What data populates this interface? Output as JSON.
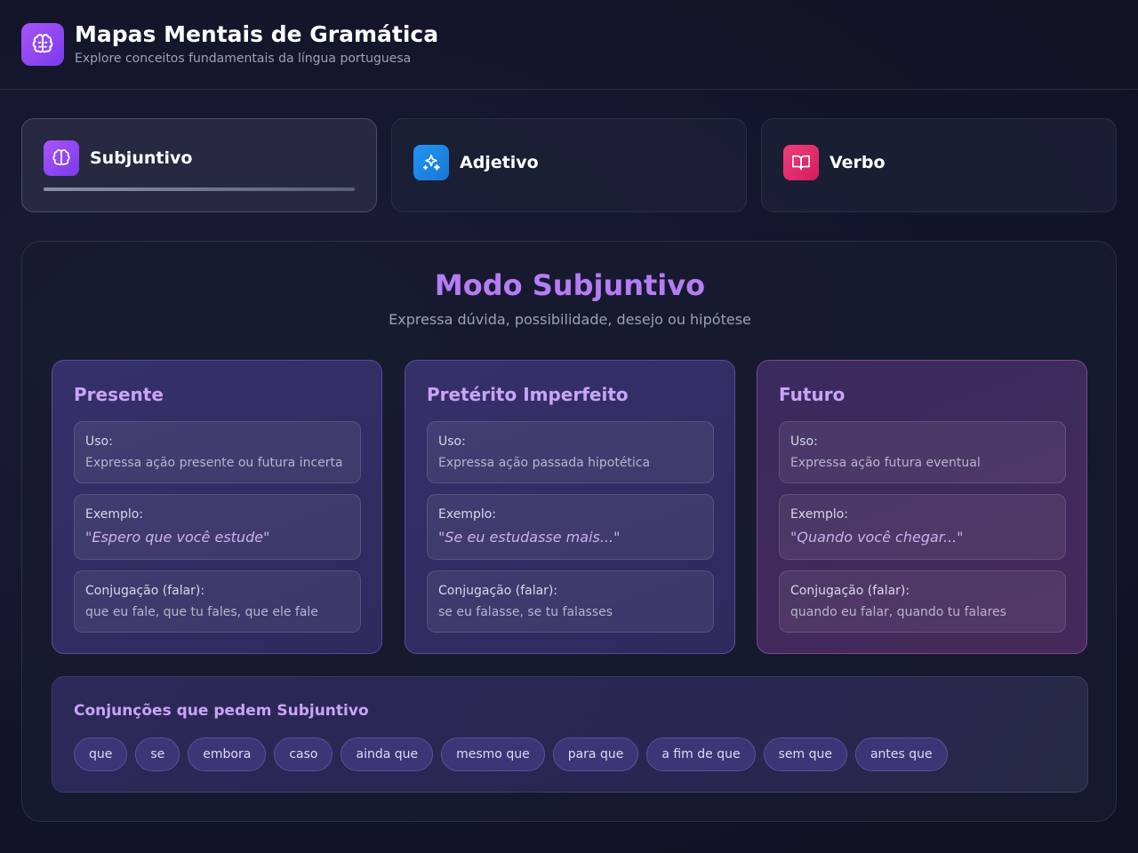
{
  "header": {
    "title": "Mapas Mentais de Gramática",
    "subtitle": "Explore conceitos fundamentais da língua portuguesa"
  },
  "tabs": [
    {
      "label": "Subjuntivo",
      "icon": "brain-icon",
      "color": "#a855f7",
      "active": true
    },
    {
      "label": "Adjetivo",
      "icon": "sparkles-icon",
      "color": "#2196f3",
      "active": false
    },
    {
      "label": "Verbo",
      "icon": "book-icon",
      "color": "#ec407a",
      "active": false
    }
  ],
  "main": {
    "title": "Modo Subjuntivo",
    "subtitle": "Expressa dúvida, possibilidade, desejo ou hipótese",
    "modes": [
      {
        "title": "Presente",
        "uso_label": "Uso:",
        "uso": "Expressa ação presente ou futura incerta",
        "exemplo_label": "Exemplo:",
        "exemplo": "Espero que você estude",
        "conj_label": "Conjugação (falar):",
        "conj": "que eu fale, que tu fales, que ele fale"
      },
      {
        "title": "Pretérito Imperfeito",
        "uso_label": "Uso:",
        "uso": "Expressa ação passada hipotética",
        "exemplo_label": "Exemplo:",
        "exemplo": "Se eu estudasse mais...",
        "conj_label": "Conjugação (falar):",
        "conj": "se eu falasse, se tu falasses"
      },
      {
        "title": "Futuro",
        "uso_label": "Uso:",
        "uso": "Expressa ação futura eventual",
        "exemplo_label": "Exemplo:",
        "exemplo": "Quando você chegar...",
        "conj_label": "Conjugação (falar):",
        "conj": "quando eu falar, quando tu falares"
      }
    ],
    "conjunctions": {
      "title": "Conjunções que pedem Subjuntivo",
      "items": [
        "que",
        "se",
        "embora",
        "caso",
        "ainda que",
        "mesmo que",
        "para que",
        "a fim de que",
        "sem que",
        "antes que"
      ]
    }
  },
  "colors": {
    "accent": "#b57cf5",
    "background": "#12142a"
  }
}
